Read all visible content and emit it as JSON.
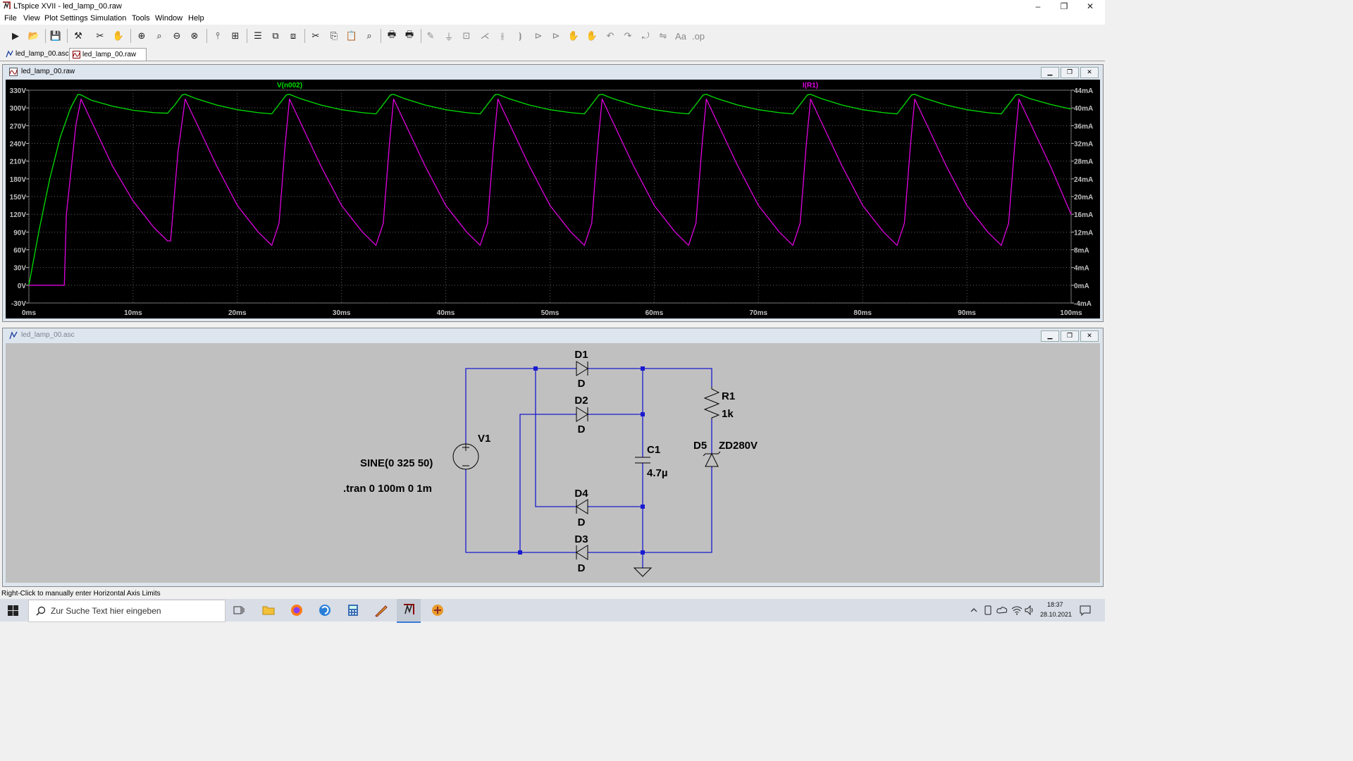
{
  "window": {
    "title": "LTspice XVII - led_lamp_00.raw",
    "minimize": "–",
    "maximize": "❐",
    "close": "✕"
  },
  "menu": [
    "File",
    "View",
    "Plot Settings",
    "Simulation",
    "Tools",
    "Window",
    "Help"
  ],
  "toolbar_icons": [
    "run-icon",
    "open-icon",
    "save-icon",
    "control-panel-icon",
    "halt-icon",
    "pan-icon",
    "zoom-in-icon",
    "zoom-area-icon",
    "zoom-out-icon",
    "zoom-fit-icon",
    "autorange-icon",
    "plot-icon",
    "tile-horizontal-icon",
    "cascade-icon",
    "tile-vertical-icon",
    "cut-icon",
    "copy-icon",
    "paste-icon",
    "find-icon",
    "print-icon",
    "print-setup-icon",
    "wire-icon",
    "ground-icon",
    "label-icon",
    "resistor-icon",
    "capacitor-icon",
    "inductor-icon",
    "diode-icon",
    "component-icon",
    "move-icon",
    "drag-icon",
    "undo-icon",
    "redo-icon",
    "rotate-icon",
    "mirror-icon",
    "text-icon",
    "spice-directive-icon"
  ],
  "tabs": [
    {
      "label": "led_lamp_00.asc",
      "icon": "schematic-icon"
    },
    {
      "label": "led_lamp_00.raw",
      "icon": "waveform-icon"
    }
  ],
  "plot_window": {
    "title": "led_lamp_00.raw",
    "traces": [
      {
        "name": "V(n002)",
        "color": "#00e000"
      },
      {
        "name": "I(R1)",
        "color": "#e000e0"
      }
    ]
  },
  "chart_data": {
    "type": "line",
    "x_ticks": [
      "0ms",
      "10ms",
      "20ms",
      "30ms",
      "40ms",
      "50ms",
      "60ms",
      "70ms",
      "80ms",
      "90ms",
      "100ms"
    ],
    "xlim": [
      0,
      100
    ],
    "left_ticks": [
      "330V",
      "300V",
      "270V",
      "240V",
      "210V",
      "180V",
      "150V",
      "120V",
      "90V",
      "60V",
      "30V",
      "0V",
      "-30V"
    ],
    "right_ticks": [
      "44mA",
      "40mA",
      "36mA",
      "32mA",
      "28mA",
      "24mA",
      "20mA",
      "16mA",
      "12mA",
      "8mA",
      "4mA",
      "0mA",
      "-4mA"
    ],
    "ylim_left": [
      -30,
      330
    ],
    "ylim_right": [
      -4,
      44
    ],
    "grid": true,
    "series": [
      {
        "name": "V(n002)",
        "axis": "left",
        "x": [
          0,
          1,
          2,
          3,
          4,
          4.7,
          5,
          6,
          8,
          10,
          12,
          13.3,
          14,
          14.7,
          15,
          16,
          18,
          20,
          22,
          23.3,
          24,
          24.7,
          25,
          26,
          28,
          30,
          32,
          33.3,
          34,
          34.7,
          35,
          36,
          38,
          40,
          42,
          43.3,
          44,
          44.7,
          45,
          46,
          48,
          50,
          52,
          53.3,
          54,
          54.7,
          55,
          56,
          58,
          60,
          62,
          63.3,
          64,
          64.7,
          65,
          66,
          68,
          70,
          72,
          73.3,
          74,
          74.7,
          75,
          76,
          78,
          80,
          82,
          83.3,
          84,
          84.7,
          85,
          86,
          88,
          90,
          92,
          93.3,
          94,
          94.7,
          95,
          96,
          98,
          100
        ],
        "y": [
          0,
          95,
          180,
          250,
          300,
          323,
          322,
          313,
          303,
          296,
          292,
          291,
          305,
          322,
          323,
          316,
          305,
          297,
          292,
          290,
          306,
          322,
          323,
          316,
          305,
          297,
          292,
          290,
          306,
          322,
          323,
          316,
          305,
          297,
          292,
          290,
          306,
          322,
          323,
          316,
          305,
          297,
          292,
          290,
          306,
          322,
          323,
          316,
          305,
          297,
          292,
          290,
          306,
          322,
          323,
          316,
          305,
          297,
          292,
          290,
          306,
          322,
          323,
          316,
          305,
          297,
          292,
          290,
          306,
          322,
          323,
          316,
          305,
          297,
          292,
          290,
          306,
          322,
          323,
          316,
          306,
          298
        ]
      },
      {
        "name": "I(R1)",
        "axis": "right",
        "x": [
          0,
          3.4,
          3.6,
          4.5,
          5,
          6,
          8,
          10,
          12,
          13.3,
          13.6,
          14.3,
          15,
          16,
          18,
          20,
          22,
          23.3,
          24,
          24.6,
          25,
          26,
          28,
          30,
          32,
          33.3,
          34,
          34.6,
          35,
          36,
          38,
          40,
          42,
          43.3,
          44,
          44.6,
          45,
          46,
          48,
          50,
          52,
          53.3,
          54,
          54.6,
          55,
          56,
          58,
          60,
          62,
          63.3,
          64,
          64.6,
          65,
          66,
          68,
          70,
          72,
          73.3,
          74,
          74.6,
          75,
          76,
          78,
          80,
          82,
          83.3,
          84,
          84.6,
          85,
          86,
          88,
          90,
          92,
          93.3,
          94,
          94.6,
          95,
          96,
          98,
          100
        ],
        "y": [
          0,
          0,
          16,
          36,
          42,
          37,
          27,
          19,
          13,
          10,
          10,
          30,
          42,
          37,
          27,
          18,
          12,
          9,
          14,
          32,
          42,
          37,
          27,
          18,
          12,
          9,
          14,
          32,
          42,
          37,
          27,
          18,
          12,
          9,
          14,
          32,
          42,
          37,
          27,
          18,
          12,
          9,
          14,
          32,
          42,
          37,
          27,
          18,
          12,
          9,
          14,
          32,
          42,
          37,
          27,
          18,
          12,
          9,
          14,
          32,
          42,
          37,
          27,
          18,
          12,
          9,
          14,
          32,
          42,
          37,
          27,
          18,
          12,
          9,
          14,
          32,
          42,
          37,
          27,
          16
        ]
      }
    ]
  },
  "schematic_window": {
    "title": "led_lamp_00.asc",
    "labels": {
      "D1": "D1",
      "D1_model": "D",
      "D2": "D2",
      "D2_model": "D",
      "D3": "D3",
      "D3_model": "D",
      "D4": "D4",
      "D4_model": "D",
      "D5": "D5",
      "D5_model": "ZD280V",
      "R1": "R1",
      "R1_value": "1k",
      "C1": "C1",
      "C1_value": "4.7µ",
      "V1": "V1",
      "V1_value": "SINE(0 325 50)",
      "directive": ".tran 0 100m 0 1m"
    }
  },
  "status": "Right-Click to manually enter Horizontal Axis Limits",
  "taskbar": {
    "search_placeholder": "Zur Suche Text hier eingeben",
    "time": "18:37",
    "date": "28.10.2021"
  }
}
